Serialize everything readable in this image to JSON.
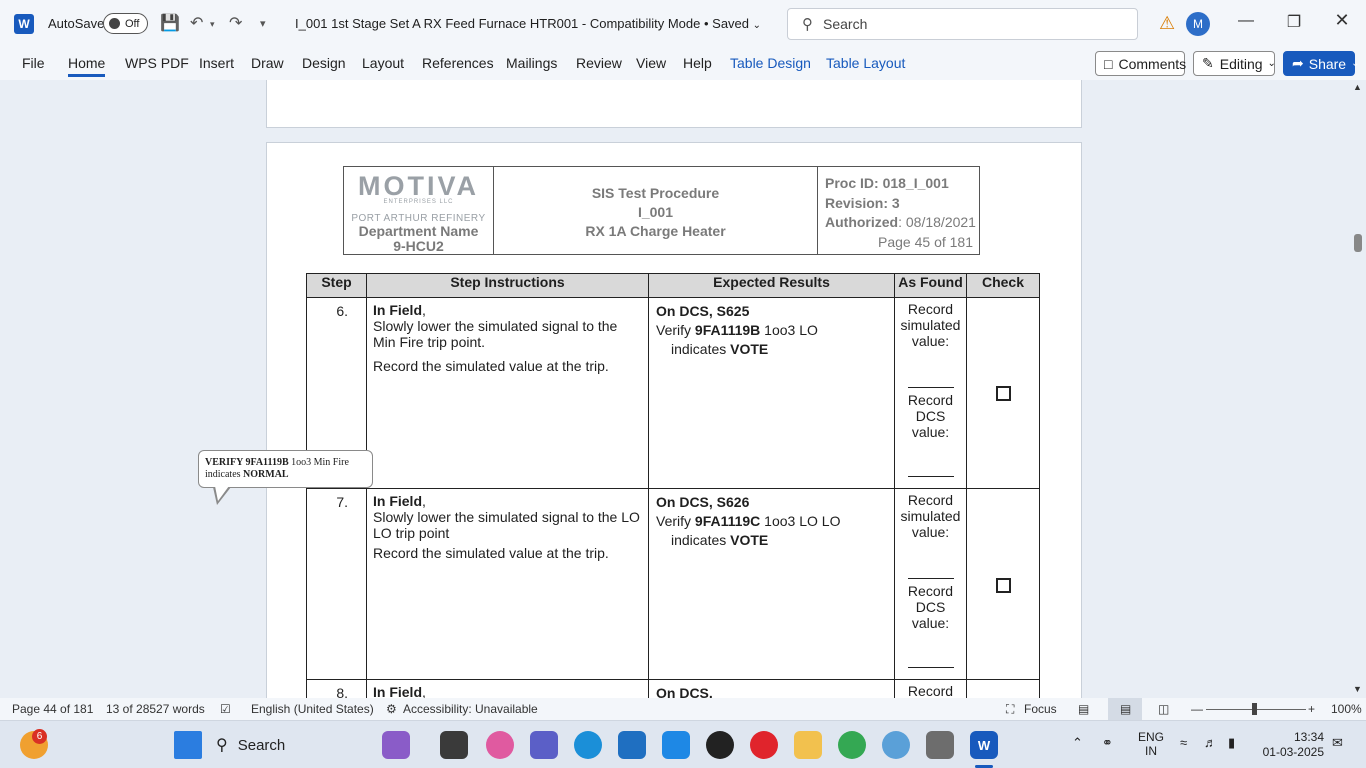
{
  "titlebar": {
    "app_letter": "W",
    "autosave_label": "AutoSave",
    "autosave_state": "Off",
    "document_title": "I_001 1st Stage Set A RX Feed Furnace HTR001  -  Compatibility Mode  •  Saved",
    "search_placeholder": "Search",
    "avatar_letter": "M"
  },
  "ribbon": {
    "tabs": [
      "File",
      "Home",
      "WPS PDF",
      "Insert",
      "Draw",
      "Design",
      "Layout",
      "References",
      "Mailings",
      "Review",
      "View",
      "Help",
      "Table Design",
      "Table Layout"
    ],
    "comments_label": "Comments",
    "editing_label": "Editing",
    "share_label": "Share"
  },
  "page_header": {
    "logo_text": "MOTIVA",
    "logo_sub": "ENTERPRISES LLC",
    "refinery": "PORT ARTHUR REFINERY",
    "dept_line1": "Department Name",
    "dept_line2": "9-HCU2",
    "title_line1": "SIS Test Procedure",
    "title_line2": "I_001",
    "title_line3": "RX 1A Charge Heater",
    "proc_id": "Proc ID: 018_I_001",
    "revision": "Revision: 3",
    "authorized_label": "Authorized",
    "authorized_date": ": 08/18/2021",
    "page_of": "Page 45 of 181"
  },
  "table": {
    "headers": [
      "Step",
      "Step Instructions",
      "Expected Results",
      "As Found",
      "Check"
    ],
    "rows": [
      {
        "step": "6.",
        "in_field": "In Field",
        "instr1": "Slowly lower the simulated signal to the Min Fire trip point.",
        "instr2": "Record the simulated value at the trip.",
        "exp_head": "On DCS, S625",
        "exp_verify": "Verify ",
        "exp_tag": "9FA1119B",
        "exp_rest": " 1oo3 LO",
        "exp_ind": "indicates ",
        "exp_state": "VOTE",
        "asf1": "Record simulated value:",
        "asf2": "Record DCS value:"
      },
      {
        "step": "7.",
        "in_field": "In Field",
        "instr1": "Slowly lower the simulated signal to the LO LO trip point",
        "instr2": "Record the simulated value at the trip.",
        "exp_head": "On DCS, S626",
        "exp_verify": "Verify ",
        "exp_tag": "9FA1119C",
        "exp_rest": " 1oo3 LO LO",
        "exp_ind": "indicates ",
        "exp_state": "VOTE",
        "asf1": "Record simulated value:",
        "asf2": "Record DCS value:"
      },
      {
        "step": "8.",
        "in_field": "In Field",
        "exp_head": "On DCS,",
        "asf1": "Record"
      }
    ]
  },
  "comment": {
    "bold1": "VERIFY 9FA1119B",
    "text1": " 1oo3 Min Fire",
    "text2": "indicates ",
    "bold2": "NORMAL"
  },
  "status": {
    "page": "Page 44 of 181",
    "words": "13 of 28527 words",
    "language": "English (United States)",
    "accessibility": "Accessibility: Unavailable",
    "focus": "Focus",
    "zoom": "100%"
  },
  "taskbar": {
    "notif_count": "6",
    "search_label": "Search",
    "lang1": "ENG",
    "lang2": "IN",
    "time": "13:34",
    "date": "01-03-2025"
  }
}
